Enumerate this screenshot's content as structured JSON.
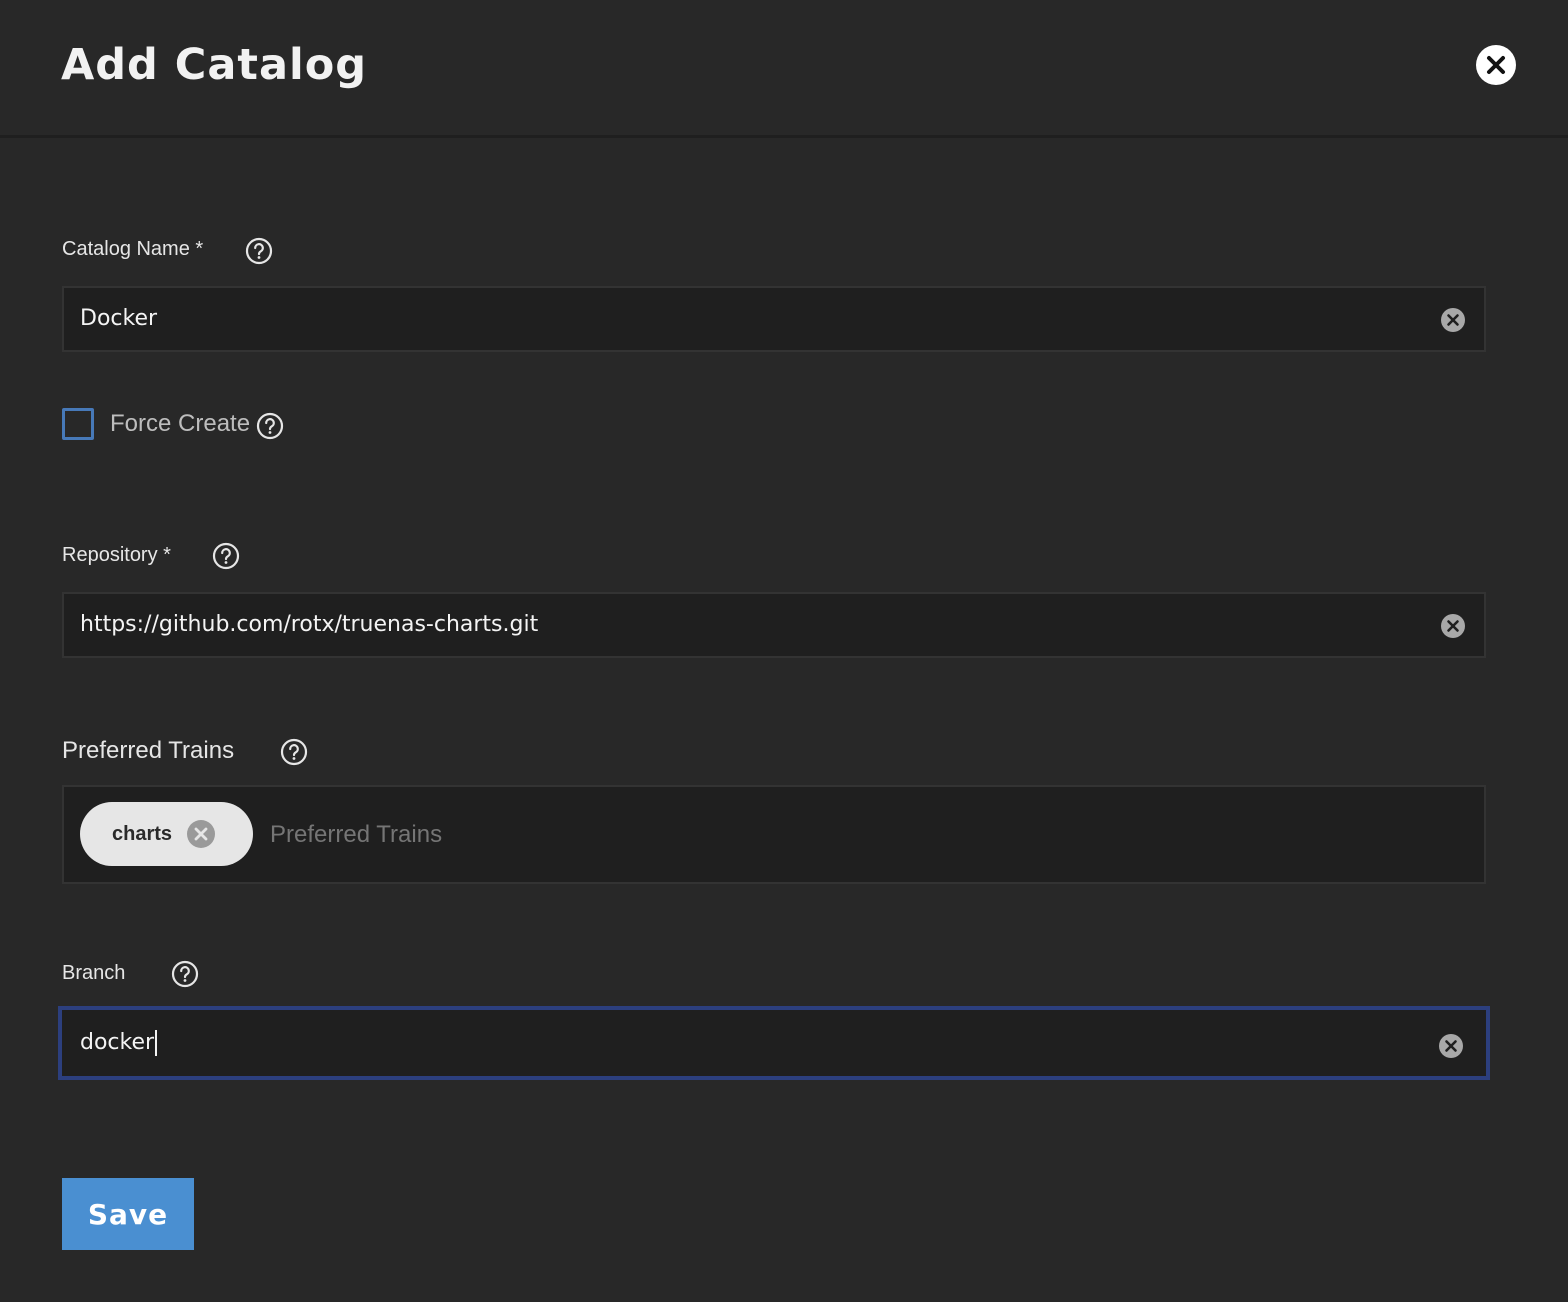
{
  "dialog": {
    "title": "Add Catalog"
  },
  "form": {
    "catalog_name": {
      "label": "Catalog Name *",
      "value": "Docker"
    },
    "force_create": {
      "label": "Force Create",
      "checked": false
    },
    "repository": {
      "label": "Repository *",
      "value": "https://github.com/rotx/truenas-charts.git"
    },
    "preferred_trains": {
      "label": "Preferred Trains",
      "chips": [
        "charts"
      ],
      "placeholder": "Preferred Trains"
    },
    "branch": {
      "label": "Branch",
      "value": "docker"
    }
  },
  "actions": {
    "save_label": "Save"
  },
  "colors": {
    "background": "#282828",
    "input_background": "#1f1f1f",
    "focus_border": "#2c3f7e",
    "checkbox_border": "#4779b8",
    "primary_button": "#4a8fd1",
    "chip_background": "#e6e6e6"
  },
  "icons": {
    "close": "close-icon",
    "help": "help-circle-icon",
    "clear": "clear-circle-icon",
    "chip_remove": "remove-circle-icon"
  }
}
